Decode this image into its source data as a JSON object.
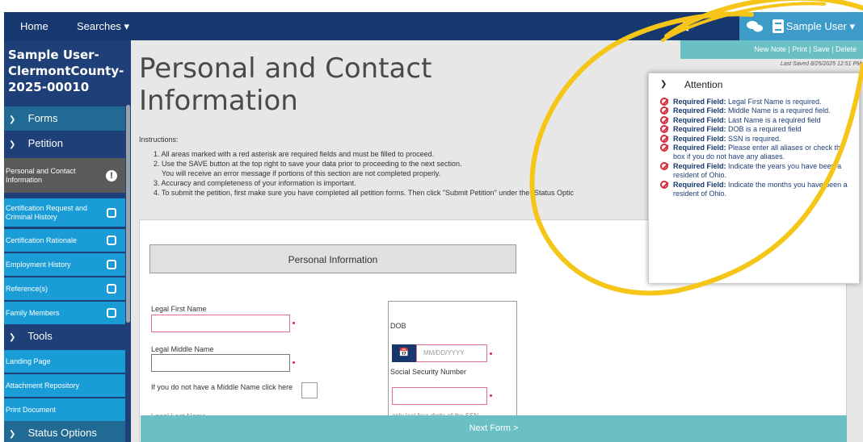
{
  "topbar": {
    "home": "Home",
    "searches": "Searches ▾",
    "user_menu": "Sample User ▾"
  },
  "sidebar": {
    "title": "Sample User-ClermontCounty-2025-00010",
    "forms": "Forms",
    "petition": "Petition",
    "items": [
      {
        "label": "Personal and Contact Information"
      },
      {
        "label": "Certification Request and Criminal History"
      },
      {
        "label": "Certification Rationale"
      },
      {
        "label": "Employment History"
      },
      {
        "label": "Reference(s)"
      },
      {
        "label": "Family Members"
      }
    ],
    "tools": "Tools",
    "tool_items": [
      "Landing Page",
      "Attachment Repository",
      "Print Document"
    ],
    "status_options": "Status Options"
  },
  "main": {
    "title": "Personal and Contact Information",
    "instructions_label": "Instructions:",
    "instructions": [
      "1. All areas marked with a red asterisk are required fields and must be filled to proceed.",
      "2. Use the SAVE button at the top right to save your data prior to proceeding to the next section.",
      "   You will receive an error message if portions of this section are not completed properly.",
      "3. Accuracy and completeness of your information is important.",
      "4. To submit the petition, first make sure you have completed all petition forms. Then click \"Submit Petition\" under the \"Status Optic"
    ],
    "actions": "New Note | Print | Save | Delete",
    "last_saved": "Last Saved 8/25/2025 12:51 PM",
    "section_header": "Personal Information",
    "fields": {
      "first_name": "Legal First Name",
      "middle_name": "Legal Middle Name",
      "no_middle": "If you do not have a Middle Name click here",
      "last_name": "Legal Last Name",
      "dob": "DOB",
      "dob_placeholder": "MM/DD/YYYY",
      "ssn": "Social Security Number",
      "ssn_help": "only last four digits of the SSN"
    },
    "next": "Next Form >"
  },
  "attention": {
    "title": "Attention",
    "items": [
      {
        "label": "Required Field:",
        "text": " Legal First Name is required."
      },
      {
        "label": "Required Field:",
        "text": " Middle Name is a required field."
      },
      {
        "label": "Required Field:",
        "text": " Last Name is a required field"
      },
      {
        "label": "Required Field:",
        "text": " DOB is a required field"
      },
      {
        "label": "Required Field:",
        "text": " SSN is required."
      },
      {
        "label": "Required Field:",
        "text": " Please enter all aliases or check the box if you do not have any aliases."
      },
      {
        "label": "Required Field:",
        "text": " Indicate the years you have been a resident of Ohio."
      },
      {
        "label": "Required Field:",
        "text": " Indicate the months you have been a resident of Ohio."
      }
    ]
  },
  "colors": {
    "navy": "#16386e",
    "sidebar_item": "#1a9dd6",
    "teal": "#6bc0c6",
    "highlight": "#f5c518",
    "required": "#d62b3b"
  }
}
